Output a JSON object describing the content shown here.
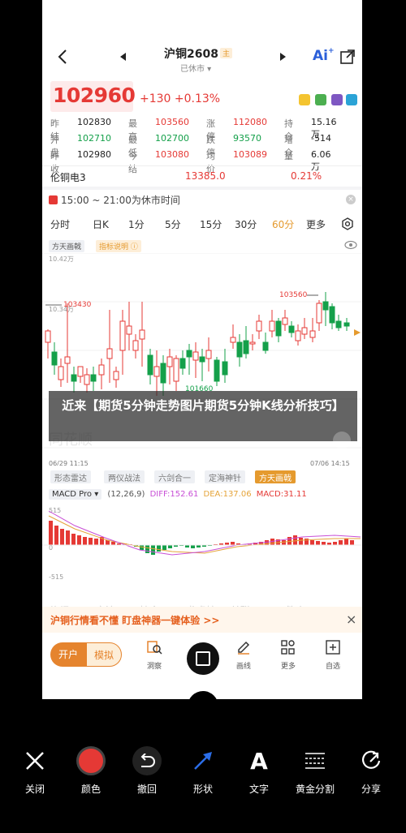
{
  "nav": {
    "title": "沪铜2608",
    "badge": "主",
    "subtitle": "已休市"
  },
  "quote": {
    "price": "102960",
    "change": "+130 +0.13%"
  },
  "stats": [
    [
      {
        "l": "昨结",
        "v": "102830",
        "c": ""
      },
      {
        "l": "最高",
        "v": "103560",
        "c": "red"
      },
      {
        "l": "涨停",
        "v": "112080",
        "c": "red"
      },
      {
        "l": "持仓",
        "v": "15.16万",
        "c": ""
      }
    ],
    [
      {
        "l": "开盘",
        "v": "102710",
        "c": "green"
      },
      {
        "l": "最低",
        "v": "102700",
        "c": "green"
      },
      {
        "l": "跌停",
        "v": "93570",
        "c": "green"
      },
      {
        "l": "增仓",
        "v": "-514",
        "c": ""
      }
    ],
    [
      {
        "l": "昨收",
        "v": "102980",
        "c": ""
      },
      {
        "l": "今结",
        "v": "103080",
        "c": "red"
      },
      {
        "l": "均价",
        "v": "103089",
        "c": "red"
      },
      {
        "l": "量",
        "v": "6.06万",
        "c": ""
      }
    ]
  ],
  "lme": {
    "name": "伦铜电3",
    "price": "13385.0",
    "change": "0.21%"
  },
  "session": "15:00 ~ 21:00为休市时间",
  "tabs": [
    "分时",
    "日K",
    "1分",
    "5分",
    "15分",
    "30分",
    "60分",
    "更多"
  ],
  "active_tab": "60分",
  "chart": {
    "indicator_tag": "方天画戟",
    "indicator_link": "指标说明",
    "y_top": "10.42万",
    "y_mid": "10.34万",
    "hi_label": "103560",
    "lo_label": "101660",
    "left_label": "103430",
    "date_left": "06/29 11:15",
    "date_right": "07/06 14:15",
    "watermark": "同花顺"
  },
  "overlay_title": "近来【期货5分钟走势图片期货5分钟K线分析技巧】",
  "tool_tags": [
    "形态雷达",
    "两仪战法",
    "六剑合一",
    "定海神针",
    "方天画戟"
  ],
  "macd": {
    "name": "MACD Pro",
    "params": "(12,26,9)",
    "diff": "DIFF:152.61",
    "dea": "DEA:137.06",
    "macd": "MACD:31.11",
    "y_top": "515",
    "y_zero": "0",
    "y_bot": "-515"
  },
  "under_tabs": [
    "资讯",
    "交流",
    "持仓",
    "龙虎榜",
    "关联",
    "简介"
  ],
  "promo": "沪铜行情看不懂  盯盘神器一键体验 >>",
  "bottom": {
    "kaihu": "开户",
    "moni": "模拟",
    "items": [
      "洞察",
      "",
      "画线",
      "更多",
      "自选"
    ]
  },
  "editor": [
    "关闭",
    "颜色",
    "撤回",
    "形状",
    "文字",
    "黄金分割",
    "分享"
  ]
}
